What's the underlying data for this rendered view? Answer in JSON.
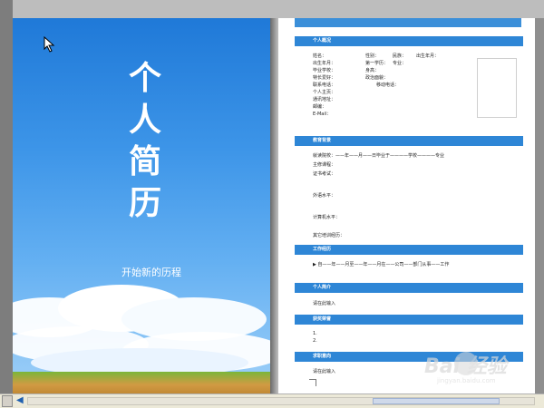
{
  "cover": {
    "title_chars": [
      "个",
      "人",
      "简",
      "历"
    ],
    "subtitle": "开始新的历程"
  },
  "resume": {
    "sections": [
      {
        "key": "personal",
        "header": "个人概况"
      },
      {
        "key": "education",
        "header": "教育背景"
      },
      {
        "key": "work",
        "header": "工作经历"
      },
      {
        "key": "intro",
        "header": "个人简介"
      },
      {
        "key": "honors",
        "header": "获奖荣誉"
      },
      {
        "key": "intent",
        "header": "求职意向"
      }
    ],
    "personal_fields": {
      "name": "姓名：",
      "gender": "性别：",
      "ethnicity": "民族：",
      "photo_label": "出生年月：",
      "birth": "出生年月：",
      "degree": "第一学历：",
      "major": "专业：",
      "school": "毕业学校：",
      "height": "身高：",
      "hobby": "特长爱好：",
      "political": "政治面貌：",
      "phone": "联系电话：",
      "email": "个人主页：",
      "address": "通讯地址：",
      "mobile": "移动电话：",
      "qq": "邮编：",
      "extra": "E-Mail："
    },
    "education_fields": {
      "period": "就读院校：——年——月——日毕业于————学校————专业",
      "courses": "主修课程：",
      "other": "证书考试：",
      "english": "外语水平：",
      "computer": "计算机水平：",
      "skills": "其它培训经历："
    },
    "work_entry": "▶ 自——年——月至——年——月在——公司——部门从事——工作",
    "intro_text": "请在此输入",
    "honors_lines": [
      "1.",
      "2."
    ],
    "intent_text": "请在此输入"
  },
  "watermark": {
    "main": "Bai 经验",
    "sub": "jingyan.baidu.com"
  },
  "colors": {
    "section_blue": "#2e86d6",
    "sky_top": "#1f79d8",
    "sky_bottom": "#9fd0f8"
  }
}
